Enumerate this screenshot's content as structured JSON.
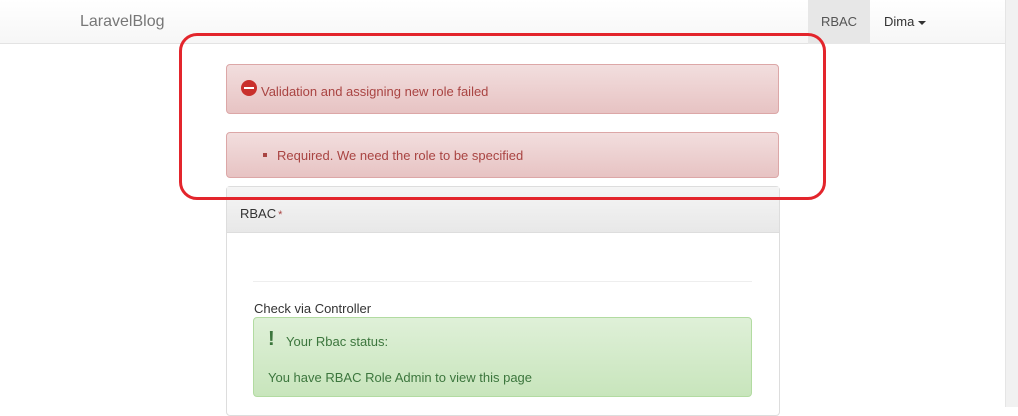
{
  "navbar": {
    "brand": "LaravelBlog",
    "items": [
      {
        "label": "RBAC"
      },
      {
        "label": "Dima"
      }
    ]
  },
  "alerts": {
    "error_title": "Validation and assigning new role failed",
    "error_items": [
      "Required. We need the role to be specified"
    ]
  },
  "panel": {
    "heading": "RBAC",
    "required_mark": "*",
    "check_label": "Check via Controller",
    "status": {
      "icon": "exclamation-icon",
      "title": "Your Rbac status:",
      "message": "You have RBAC Role Admin to view this page"
    }
  },
  "colors": {
    "danger_text": "#a94442",
    "success_text": "#3c763d",
    "annotation": "#e3252c"
  }
}
